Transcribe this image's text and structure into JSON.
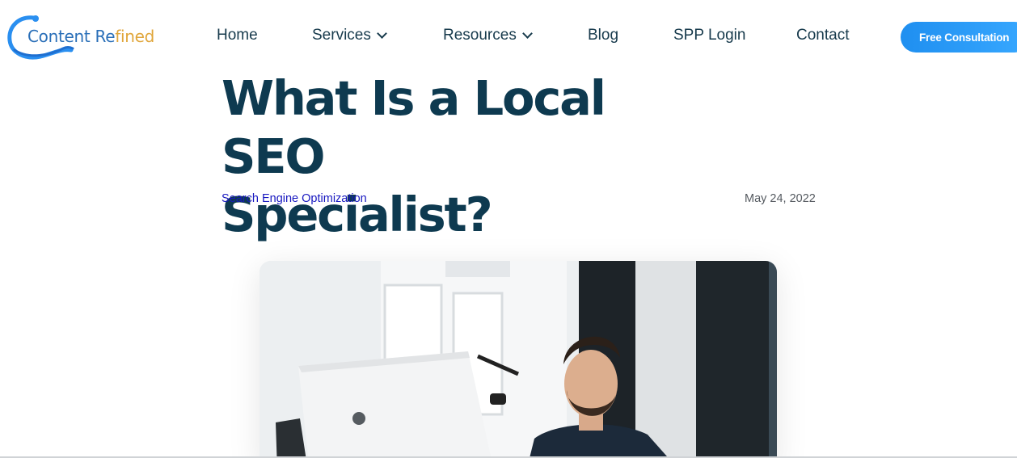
{
  "logo": {
    "part1": "Content Re",
    "part2": "fined",
    "icon": "wave-swirl-logo-icon",
    "colors": {
      "primary": "#2a6fb8",
      "accent": "#e0a63b"
    }
  },
  "nav": {
    "items": [
      {
        "label": "Home",
        "has_dropdown": false
      },
      {
        "label": "Services",
        "has_dropdown": true
      },
      {
        "label": "Resources",
        "has_dropdown": true
      },
      {
        "label": "Blog",
        "has_dropdown": false
      },
      {
        "label": "SPP Login",
        "has_dropdown": false
      },
      {
        "label": "Contact",
        "has_dropdown": false
      }
    ],
    "cta_label": "Free Consultation",
    "cta_color": "#1f8ff0"
  },
  "article": {
    "title_line1": "What Is a Local SEO",
    "title_line2": "Specialist?",
    "category": "Search Engine Optimization",
    "date": "May 24, 2022",
    "hero_image": "man-working-at-computer-photo"
  }
}
